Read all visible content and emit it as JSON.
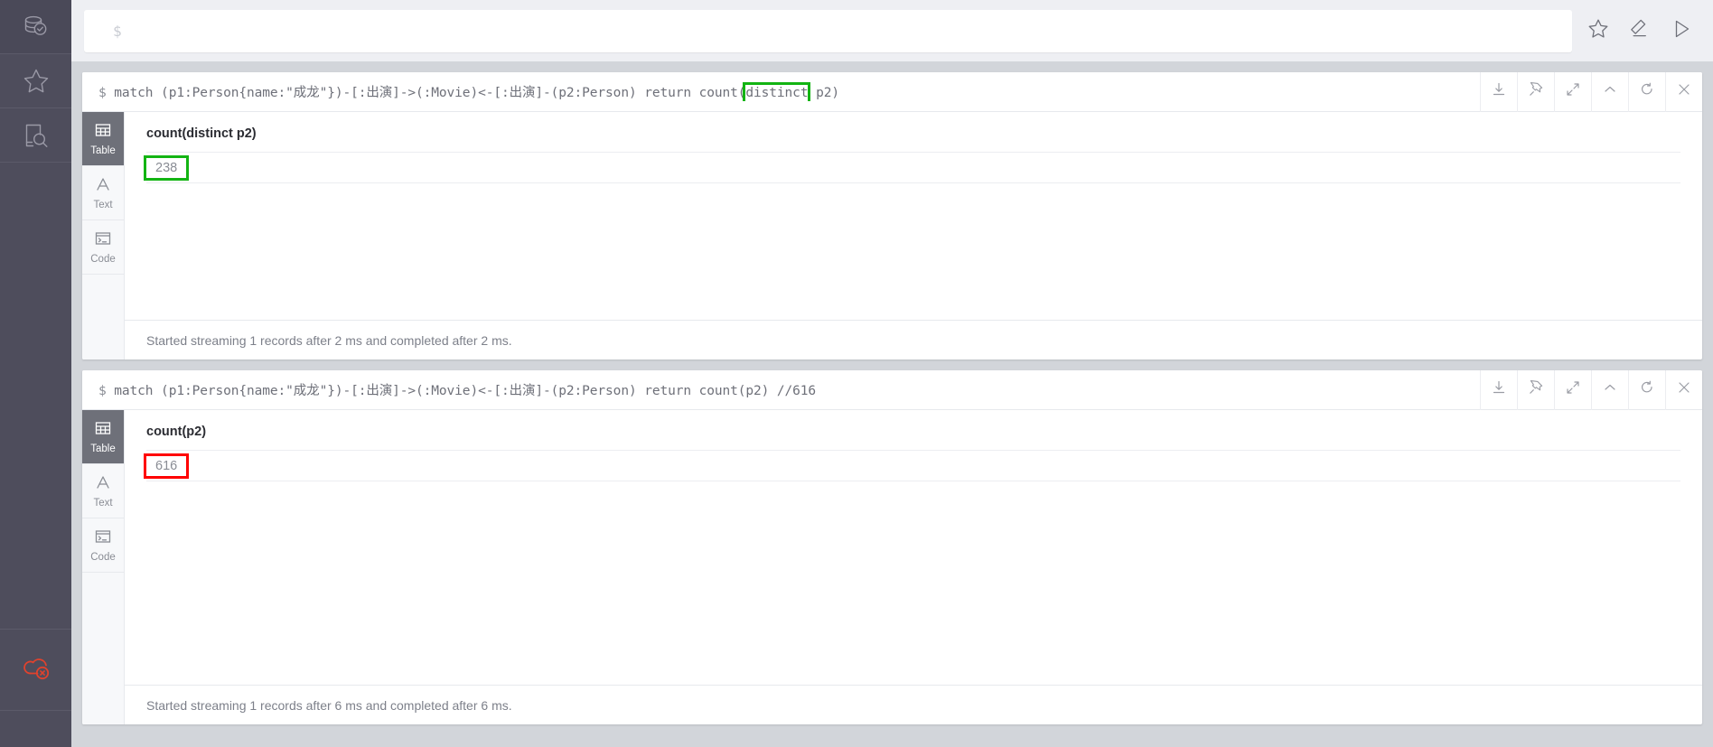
{
  "app": {
    "name": "neo4j-browser"
  },
  "sidebar": {
    "items": [
      {
        "icon": "database-check-icon",
        "name": "sidebar-item-database",
        "active": true
      },
      {
        "icon": "star-icon",
        "name": "sidebar-item-favorites",
        "active": false
      },
      {
        "icon": "document-search-icon",
        "name": "sidebar-item-documents",
        "active": false
      }
    ],
    "bottom": {
      "icon": "cloud-disconnected-icon",
      "name": "sidebar-item-connection-status",
      "color": "#E0422D"
    }
  },
  "editor": {
    "prompt": "$",
    "placeholder": "$",
    "value": "",
    "actions": [
      {
        "icon": "star-icon",
        "name": "editor-favorite-button",
        "label": "Favorite"
      },
      {
        "icon": "eraser-icon",
        "name": "editor-clear-button",
        "label": "Clear"
      },
      {
        "icon": "play-icon",
        "name": "editor-run-button",
        "label": "Run"
      }
    ]
  },
  "frame_buttons": [
    {
      "icon": "download-icon",
      "name": "frame-download-button",
      "label": "Download"
    },
    {
      "icon": "pin-icon",
      "name": "frame-pin-button",
      "label": "Pin"
    },
    {
      "icon": "expand-icon",
      "name": "frame-expand-button",
      "label": "Expand"
    },
    {
      "icon": "chevron-up-icon",
      "name": "frame-collapse-button",
      "label": "Collapse"
    },
    {
      "icon": "refresh-icon",
      "name": "frame-rerun-button",
      "label": "Rerun"
    },
    {
      "icon": "close-icon",
      "name": "frame-close-button",
      "label": "Close"
    }
  ],
  "view_tabs": [
    {
      "label": "Table",
      "icon": "table-icon"
    },
    {
      "label": "Text",
      "icon": "text-icon"
    },
    {
      "label": "Code",
      "icon": "code-icon"
    }
  ],
  "frames": [
    {
      "prompt": "$",
      "query_before": "match (p1:Person{name:\"成龙\"})-[:出演]->(:Movie)<-[:出演]-(p2:Person) return count(",
      "query_highlight": "distinct",
      "query_after": " p2)",
      "highlight_color": "#13B413",
      "column_header": "count(distinct p2)",
      "value": "238",
      "value_box_color": "#13B413",
      "status": "Started streaming 1 records after 2 ms and completed after 2 ms.",
      "active_tab": "Table"
    },
    {
      "prompt": "$",
      "query_before": "match (p1:Person{name:\"成龙\"})-[:出演]->(:Movie)<-[:出演]-(p2:Person) return count(p2) //616",
      "query_highlight": "",
      "query_after": "",
      "highlight_color": "",
      "column_header": "count(p2)",
      "value": "616",
      "value_box_color": "#FF0000",
      "status": "Started streaming 1 records after 6 ms and completed after 6 ms.",
      "active_tab": "Table"
    }
  ]
}
